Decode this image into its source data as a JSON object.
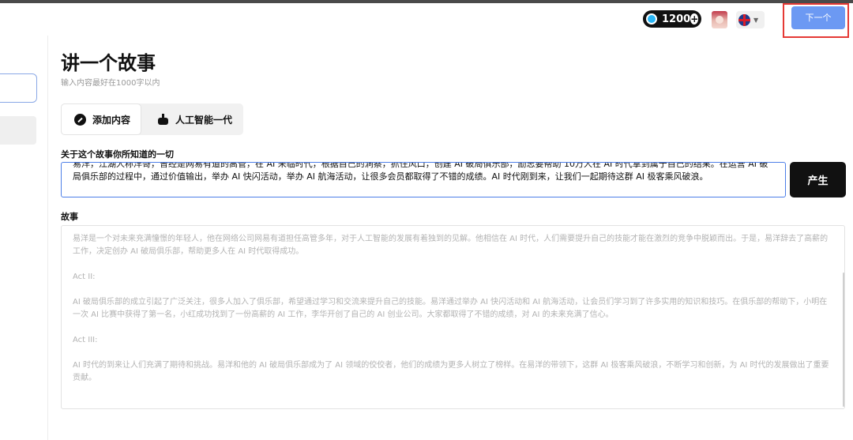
{
  "topbar": {
    "credits": "1200",
    "credits_plus": "+",
    "lang_caret": "▼",
    "next_label": "下一个"
  },
  "main": {
    "title": "讲一个故事",
    "subtitle": "输入内容最好在1000字以内",
    "tabs": [
      {
        "label": "添加内容",
        "icon": "edit-circle-icon"
      },
      {
        "label": "人工智能一代",
        "icon": "robot-icon"
      }
    ],
    "about_label": "关于这个故事你所知道的一切",
    "about_value": "易洋，江湖人称洋哥，曾经是网易有道的高管，在 AI 来临时代，根据自己的洞察，抓住风口，创建 AI 破局俱乐部，励志要帮助 10万人在 AI 时代拿到属于自己的结果。在运营 AI 破局俱乐部的过程中，通过价值输出，举办 AI 快闪活动，举办 AI 航海活动，让很多会员都取得了不错的成绩。AI 时代刚到来，让我们一起期待这群 AI 极客乘风破浪。",
    "generate_label": "产生",
    "story_label": "故事",
    "story_paragraphs": [
      "易洋是一个对未来充满憧憬的年轻人，他在网络公司网易有道担任高管多年，对于人工智能的发展有着独到的见解。他相信在 AI 时代，人们需要提升自己的技能才能在激烈的竞争中脱颖而出。于是，易洋辞去了高薪的工作，决定创办 AI 破局俱乐部，帮助更多人在 AI 时代取得成功。",
      "Act II:",
      "AI 破局俱乐部的成立引起了广泛关注，很多人加入了俱乐部，希望通过学习和交流来提升自己的技能。易洋通过举办 AI 快闪活动和 AI 航海活动，让会员们学习到了许多实用的知识和技巧。在俱乐部的帮助下，小明在一次 AI 比赛中获得了第一名，小红成功找到了一份高薪的 AI 工作，李华开创了自己的 AI 创业公司。大家都取得了不错的成绩，对 AI 的未来充满了信心。",
      "Act III:",
      "AI 时代的到来让人们充满了期待和挑战。易洋和他的 AI 破局俱乐部成为了 AI 领域的佼佼者，他们的成绩为更多人树立了榜样。在易洋的带领下，这群 AI 极客乘风破浪，不断学习和创新，为 AI 时代的发展做出了重要贡献。"
    ]
  },
  "colors": {
    "accent": "#6c99f3",
    "highlight_frame": "#e53935",
    "input_border": "#4d7fe8",
    "dark_button": "#111111"
  }
}
